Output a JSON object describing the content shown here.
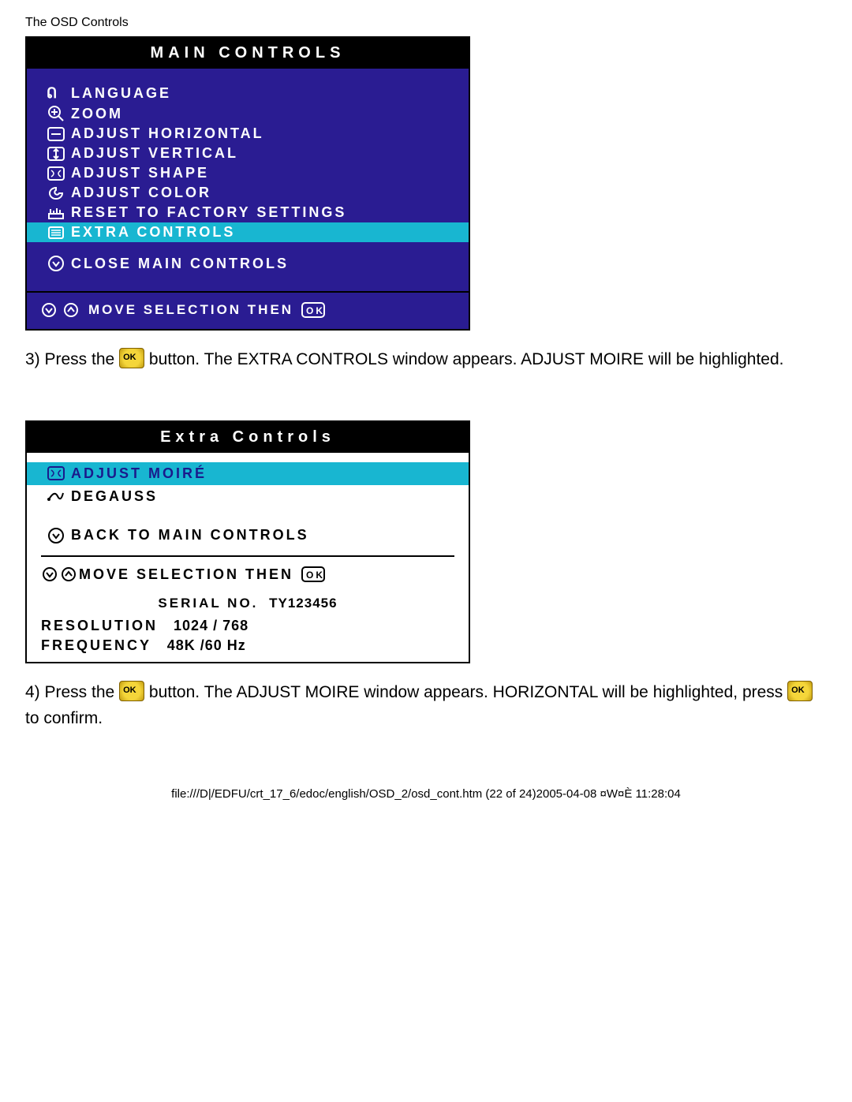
{
  "header": {
    "title": "The OSD Controls"
  },
  "main_panel": {
    "title": "MAIN CONTROLS",
    "items": [
      {
        "label": "LANGUAGE",
        "icon": "language"
      },
      {
        "label": "ZOOM",
        "icon": "zoom"
      },
      {
        "label": "ADJUST HORIZONTAL",
        "icon": "horiz"
      },
      {
        "label": "ADJUST VERTICAL",
        "icon": "vert"
      },
      {
        "label": "ADJUST SHAPE",
        "icon": "shape"
      },
      {
        "label": "ADJUST COLOR",
        "icon": "color"
      },
      {
        "label": "RESET TO FACTORY SETTINGS",
        "icon": "reset"
      },
      {
        "label": "EXTRA CONTROLS",
        "icon": "extra",
        "selected": true
      }
    ],
    "close_label": "CLOSE MAIN CONTROLS",
    "footer": "MOVE SELECTION THEN"
  },
  "step3": {
    "part1": "3) Press the ",
    "part2": " button. The EXTRA CONTROLS window appears. ADJUST MOIRE will be highlighted."
  },
  "extra_panel": {
    "title": "Extra Controls",
    "items": [
      {
        "label": "ADJUST MOIRÉ",
        "icon": "moire",
        "selected": true
      },
      {
        "label": "DEGAUSS",
        "icon": "degauss"
      }
    ],
    "back_label": "BACK TO MAIN CONTROLS",
    "footer": "MOVE SELECTION THEN",
    "serial_label": "SERIAL NO.",
    "serial_value": "TY123456",
    "resolution_label": "RESOLUTION",
    "resolution_value": "1024 / 768",
    "frequency_label": "FREQUENCY",
    "frequency_value": "48K /60 Hz"
  },
  "step4": {
    "part1": "4) Press the ",
    "part2": " button. The ADJUST MOIRE window appears. HORIZONTAL will be highlighted, press",
    "part3": " to confirm."
  },
  "footer_path": "file:///D|/EDFU/crt_17_6/edoc/english/OSD_2/osd_cont.htm (22 of 24)2005-04-08 ¤W¤È 11:28:04"
}
